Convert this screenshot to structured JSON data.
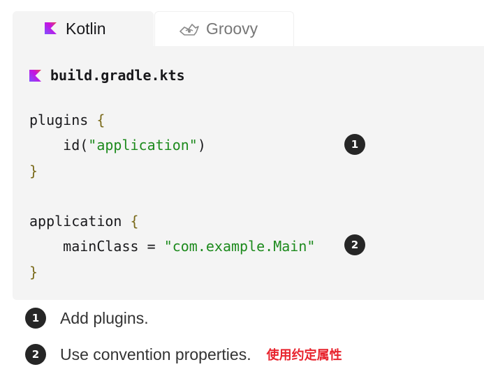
{
  "tabs": [
    {
      "label": "Kotlin",
      "icon": "kotlin-logo-icon",
      "active": true
    },
    {
      "label": "Groovy",
      "icon": "groovy-logo-icon",
      "active": false
    }
  ],
  "code_block": {
    "file_name": "build.gradle.kts",
    "file_icon": "kotlin-logo-icon",
    "lines": {
      "l1_kw": "plugins",
      "l1_brace": "{",
      "l2_fn": "id(",
      "l2_str": "\"application\"",
      "l2_close": ")",
      "l3_brace": "}",
      "l5_kw": "application",
      "l5_brace": "{",
      "l6_name": "mainClass",
      "l6_eq": "=",
      "l6_str": "\"com.example.Main\"",
      "l7_brace": "}"
    },
    "callouts": [
      "1",
      "2"
    ]
  },
  "notes": [
    {
      "num": "1",
      "text": "Add plugins.",
      "annotation": ""
    },
    {
      "num": "2",
      "text": "Use convention properties.",
      "annotation": "使用约定属性"
    }
  ],
  "colors": {
    "kotlin_gradient_start": "#7F52FF",
    "kotlin_gradient_end": "#E44857",
    "string": "#1d8a1d",
    "brace": "#7a6a1a",
    "annotation_red": "#e8232d",
    "callout_bg": "#262626"
  }
}
